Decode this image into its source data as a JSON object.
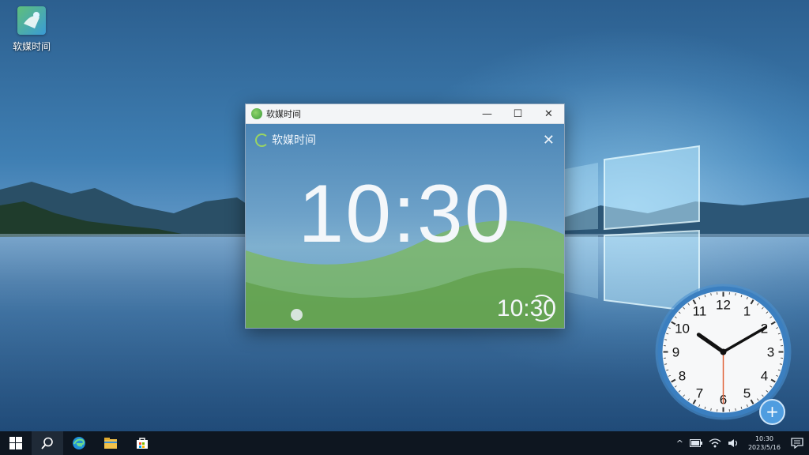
{
  "desktop": {
    "icon": {
      "label": "软媒时间",
      "sublabel": ""
    }
  },
  "window": {
    "title": "软媒时间",
    "minimize_glyph": "—",
    "maximize_glyph": "☐",
    "close_glyph": "✕",
    "brand": "软媒时间",
    "inner_close_glyph": "✕",
    "big_time": "10:30",
    "small_time": "10:30"
  },
  "clock_widget": {
    "numbers": [
      "12",
      "1",
      "2",
      "3",
      "4",
      "5",
      "6",
      "7",
      "8",
      "9",
      "10",
      "11"
    ],
    "hour": 10,
    "minute": 10,
    "second": 30,
    "add_glyph": "+"
  },
  "taskbar": {
    "tray": {
      "chevron": "^",
      "time": "10:30",
      "date": "2023/5/16"
    }
  },
  "colors": {
    "accent": "#4f9de0",
    "taskbar": "#0e1620",
    "second_hand": "#e0643a"
  },
  "icons": [
    "windows-start-icon",
    "search-icon",
    "edge-icon",
    "file-explorer-icon",
    "store-icon",
    "chevron-up-icon",
    "battery-icon",
    "network-icon",
    "volume-icon",
    "notification-icon"
  ]
}
